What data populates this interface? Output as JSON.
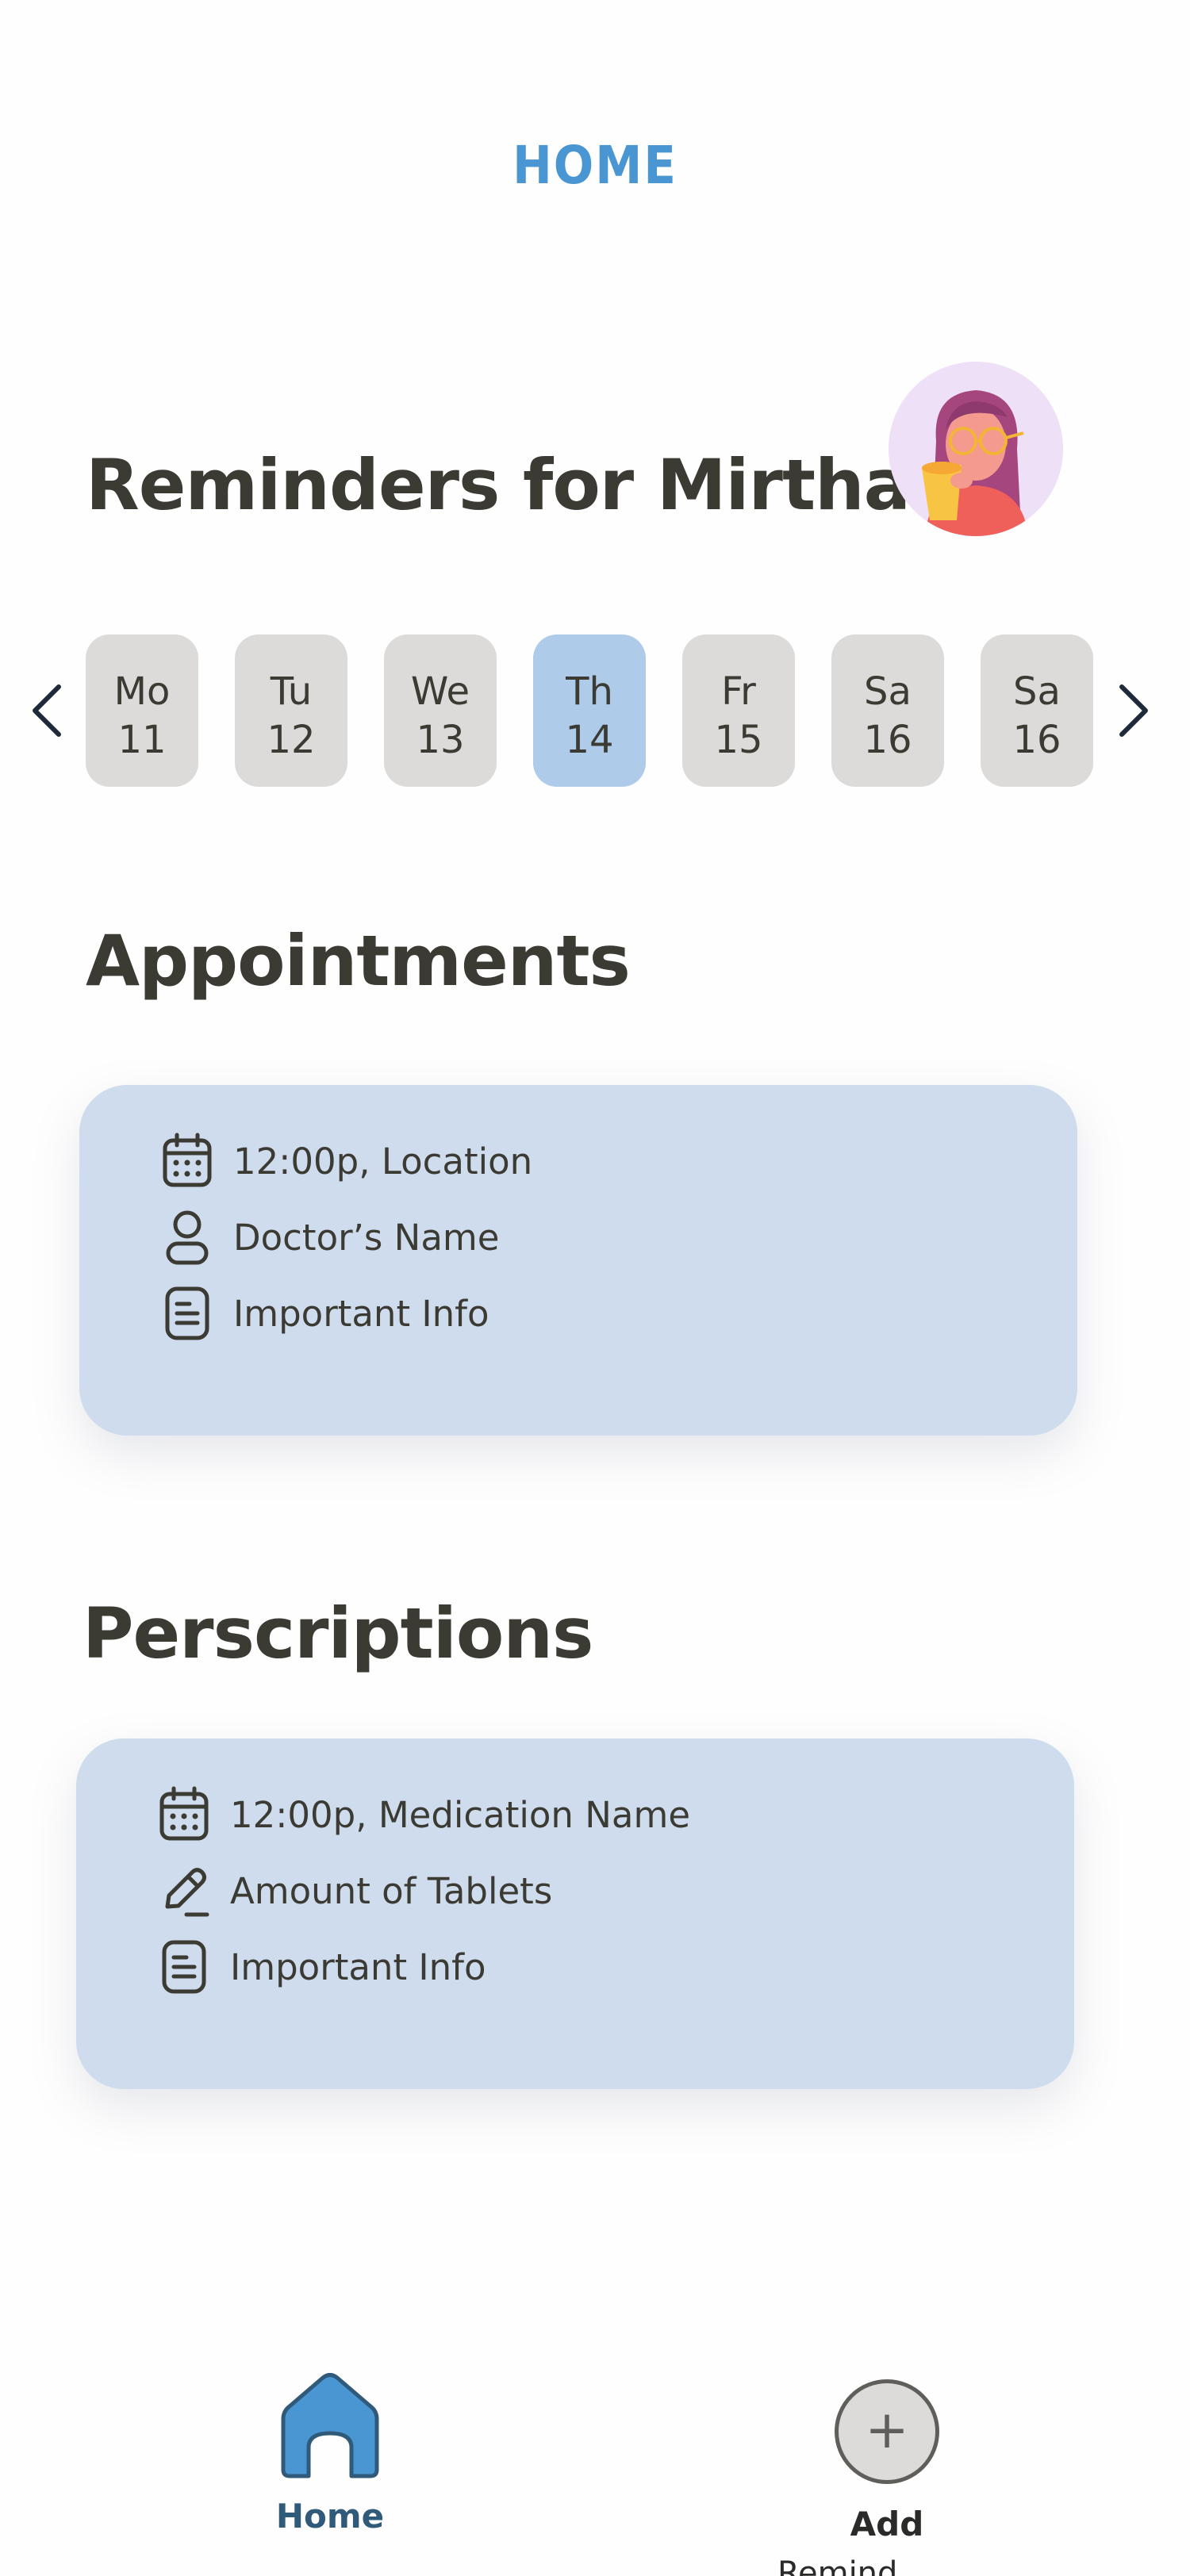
{
  "header": {
    "title": "HOME"
  },
  "greeting": "Reminders for Mirtha",
  "week": {
    "days": [
      {
        "name": "Mo",
        "num": "11"
      },
      {
        "name": "Tu",
        "num": "12"
      },
      {
        "name": "We",
        "num": "13"
      },
      {
        "name": "Th",
        "num": "14"
      },
      {
        "name": "Fr",
        "num": "15"
      },
      {
        "name": "Sa",
        "num": "16"
      },
      {
        "name": "Sa",
        "num": "16"
      }
    ],
    "selected": "Th 14"
  },
  "appointments": {
    "title": "Appointments",
    "rows": [
      {
        "icon": "calendar-icon",
        "text": "12:00p, Location"
      },
      {
        "icon": "person-icon",
        "text": "Doctor’s Name"
      },
      {
        "icon": "document-icon",
        "text": "Important Info"
      }
    ]
  },
  "prescriptions": {
    "title": "Perscriptions",
    "rows": [
      {
        "icon": "calendar-icon",
        "text": "12:00p, Medication Name"
      },
      {
        "icon": "pencil-icon",
        "text": "Amount of Tablets"
      },
      {
        "icon": "document-icon",
        "text": "Important Info"
      }
    ]
  },
  "nav": {
    "home_label": "Home",
    "add_label": "Add",
    "add_symbol": "+",
    "extra_label": "Remind..."
  },
  "colors": {
    "accent": "#4a96d2",
    "card": "#cfdced",
    "day_selected": "#afcbea",
    "day": "#dcdbda",
    "text": "#3b3a33"
  }
}
